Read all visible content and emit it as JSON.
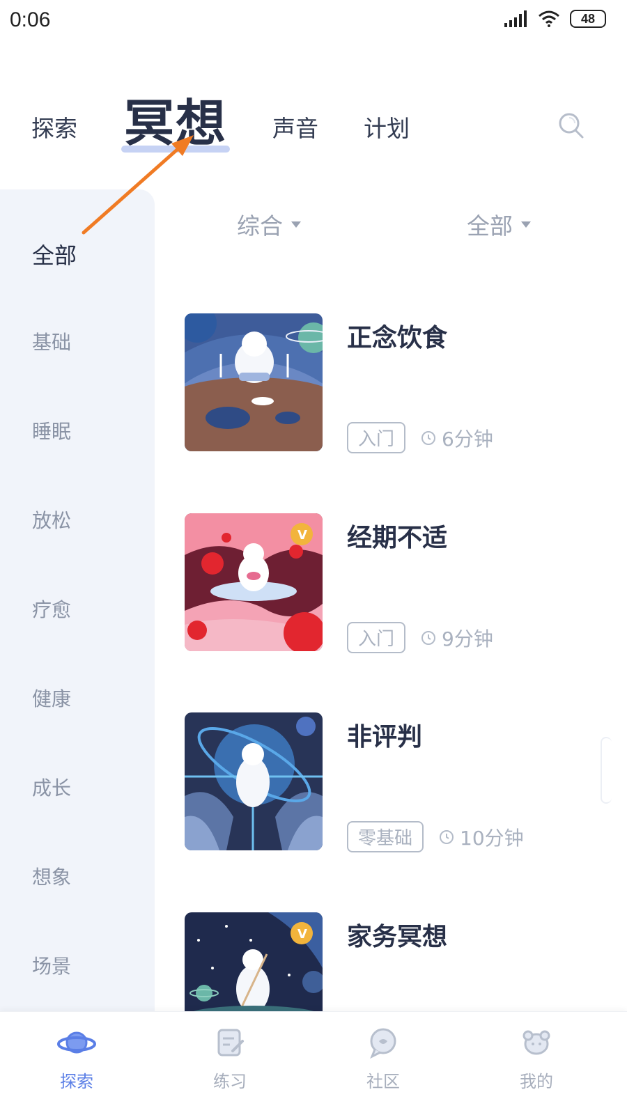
{
  "status": {
    "time": "0:06",
    "battery": "48"
  },
  "tabs": [
    {
      "label": "探索",
      "active": false
    },
    {
      "label": "冥想",
      "active": true
    },
    {
      "label": "声音",
      "active": false
    },
    {
      "label": "计划",
      "active": false
    }
  ],
  "filters": {
    "sort": "综合",
    "scope": "全部"
  },
  "sidebar": {
    "items": [
      {
        "label": "全部",
        "active": true
      },
      {
        "label": "基础"
      },
      {
        "label": "睡眠"
      },
      {
        "label": "放松"
      },
      {
        "label": "疗愈"
      },
      {
        "label": "健康"
      },
      {
        "label": "成长"
      },
      {
        "label": "想象"
      },
      {
        "label": "场景"
      }
    ]
  },
  "cards": [
    {
      "title": "正念饮食",
      "level": "入门",
      "duration": "6分钟",
      "vip": false
    },
    {
      "title": "经期不适",
      "level": "入门",
      "duration": "9分钟",
      "vip": true
    },
    {
      "title": "非评判",
      "level": "零基础",
      "duration": "10分钟",
      "vip": false
    },
    {
      "title": "家务冥想",
      "level": "",
      "duration": "",
      "vip": true
    }
  ],
  "bottom_nav": [
    {
      "label": "探索",
      "active": true,
      "icon": "planet-icon"
    },
    {
      "label": "练习",
      "active": false,
      "icon": "note-icon"
    },
    {
      "label": "社区",
      "active": false,
      "icon": "chat-bubble-icon"
    },
    {
      "label": "我的",
      "active": false,
      "icon": "profile-icon"
    }
  ],
  "colors": {
    "accent": "#5a7ee6",
    "annotation": "#f07b24",
    "sidebar_bg": "#f1f4fa"
  }
}
